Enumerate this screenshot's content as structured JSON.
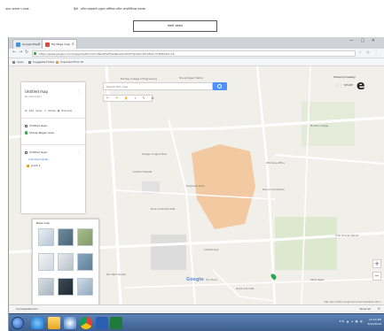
{
  "document": {
    "header_left": "अमल आश्वस्त न अलख -",
    "header_right": "हिंदी -   अनिल आव्हाडांनी अनुवाद अतिरिक्त अनिल आपार्टमेंटिफाइ अव्यवक -",
    "box_caption": "सावली अवकाश"
  },
  "browser": {
    "tabs": [
      {
        "label": "Google Maps"
      },
      {
        "label": "My Maps map"
      }
    ],
    "window_controls": "— ▢ ✕",
    "url": "https://www.google.com/maps/d/edit?mid=1NwH5v0Fqkz8uaQm8x2T3yL&ll=18.5204,73.8567&z=16",
    "omnibox_icons": "☆ ◎ ⋮",
    "bookmarks": [
      {
        "label": "Apps"
      },
      {
        "label": "Suggested Sites"
      },
      {
        "label": "Imported From IE"
      }
    ]
  },
  "map": {
    "search_placeholder": "Search this map",
    "undo_controls": "↶ ↷ ✋ ⌖ ✎ ⇄",
    "account_label": "Shared privately",
    "big_letter": "e",
    "apps_icon_glyph": "⋮⋮⋮",
    "share_label": "SHARE",
    "labels": [
      "Bombay College of Engineering",
      "Shivaji Nagar Station",
      "College of Agriculture",
      "RTO Pune Office",
      "Deccan Gymkhana",
      "Krishna Hospital",
      "Modern College",
      "Fergusson Road",
      "Tilak Smarak Mandir",
      "Sakal Nagar",
      "Shri Ram Temple",
      "Chatushringi",
      "Pune University Gate",
      "Good Luck Cafe"
    ],
    "panel": {
      "title": "Untitled map",
      "subtitle": "No description",
      "menu_glyph": "⋮",
      "actions": "⊕ Add layer  ⇪ Share  ◉ Preview",
      "layer1_name": "Untitled layer",
      "layer2_name": "Shivaji Nagar Area",
      "layer3_name": "Untitled layer",
      "layer3_link": "Individual styles",
      "layer3_item": "point 1"
    },
    "basemap": {
      "title": "Base map"
    },
    "google_logo": "Google",
    "google_sub": "My Maps",
    "zoom_in": "+",
    "zoom_out": "−",
    "footer": "Map data ©2016 Google  Terms  Send feedback  200 m"
  },
  "downloads": {
    "item": "mymapdata.kml",
    "show_all": "Show all",
    "close": "✕"
  },
  "taskbar": {
    "tray": "EN ▲ ◂ ▦ ◐",
    "time": "12:14 PM",
    "date": "8/12/2016"
  }
}
